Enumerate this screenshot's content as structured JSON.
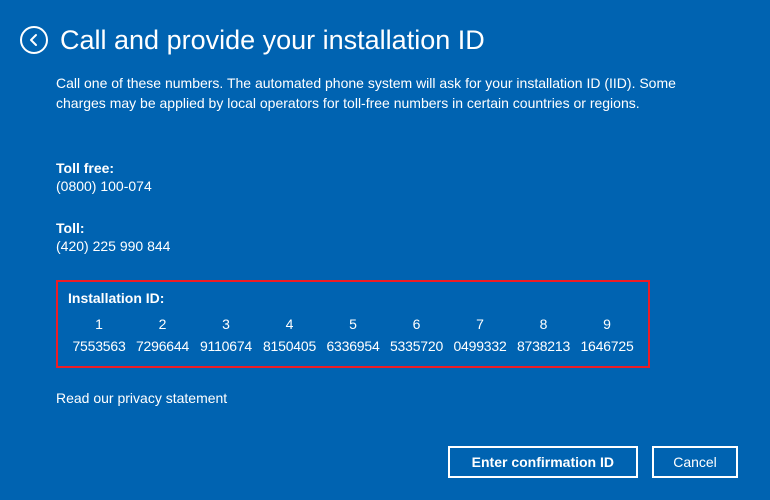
{
  "title": "Call and provide your installation ID",
  "description": "Call one of these numbers. The automated phone system will ask for your installation ID (IID). Some charges may be applied by local operators for toll-free numbers in certain countries or regions.",
  "phones": {
    "toll_free_label": "Toll free:",
    "toll_free_number": "(0800) 100-074",
    "toll_label": "Toll:",
    "toll_number": "(420) 225 990 844"
  },
  "iid": {
    "label": "Installation ID:",
    "groups": [
      {
        "index": "1",
        "value": "7553563"
      },
      {
        "index": "2",
        "value": "7296644"
      },
      {
        "index": "3",
        "value": "9110674"
      },
      {
        "index": "4",
        "value": "8150405"
      },
      {
        "index": "5",
        "value": "6336954"
      },
      {
        "index": "6",
        "value": "5335720"
      },
      {
        "index": "7",
        "value": "0499332"
      },
      {
        "index": "8",
        "value": "8738213"
      },
      {
        "index": "9",
        "value": "1646725"
      }
    ]
  },
  "privacy_link": "Read our privacy statement",
  "buttons": {
    "enter_confirmation": "Enter confirmation ID",
    "cancel": "Cancel"
  },
  "colors": {
    "background": "#0063b1",
    "highlight_border": "#ed1c24"
  }
}
